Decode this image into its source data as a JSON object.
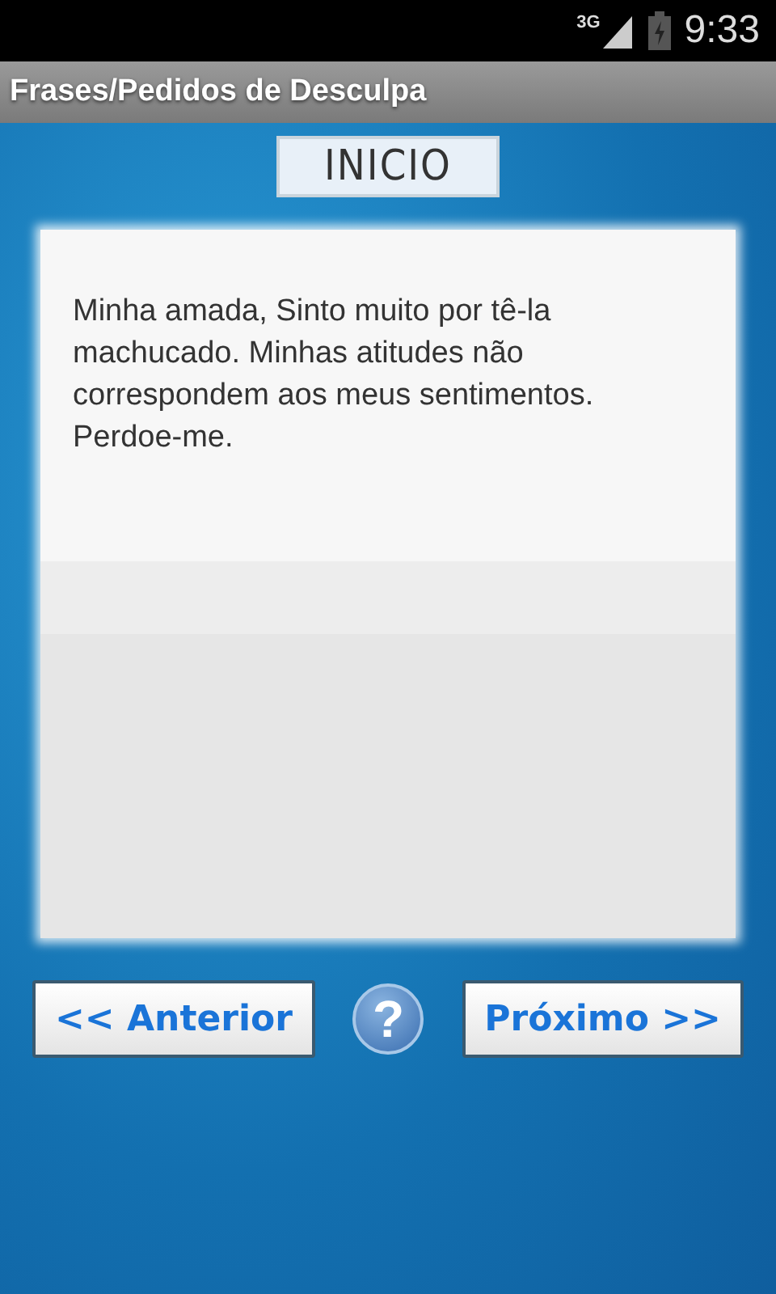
{
  "status_bar": {
    "network": "3G",
    "time": "9:33"
  },
  "action_bar": {
    "title": "Frases/Pedidos de Desculpa"
  },
  "header_button": {
    "label": "INICIO"
  },
  "message": {
    "text": "Minha amada, Sinto muito por tê-la machucado. Minhas atitudes não correspondem aos meus sentimentos. Perdoe-me."
  },
  "nav": {
    "previous": "<< Anterior",
    "help": "?",
    "next": "Próximo >>"
  }
}
